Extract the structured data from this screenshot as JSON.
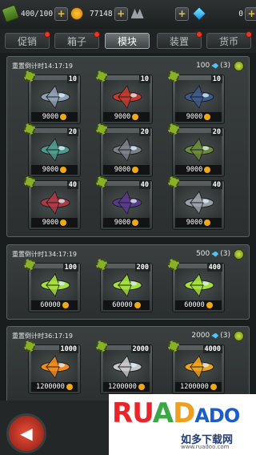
{
  "resources": {
    "energy": "400/100",
    "coins": "77148",
    "gems": "0"
  },
  "tabs": [
    {
      "label": "促销",
      "badge": true
    },
    {
      "label": "箱子",
      "badge": true
    },
    {
      "label": "模块",
      "badge": false,
      "active": true
    },
    {
      "label": "装置",
      "badge": true
    },
    {
      "label": "货币",
      "badge": true
    }
  ],
  "sections": [
    {
      "timer": "重置倒计时14:17:19",
      "cost": "100",
      "count": "(3)",
      "items": [
        {
          "level": "10",
          "price": "9000",
          "color": "#8fa0b3"
        },
        {
          "level": "10",
          "price": "9000",
          "color": "#c23a2e"
        },
        {
          "level": "10",
          "price": "9000",
          "color": "#3d5a8a"
        },
        {
          "level": "20",
          "price": "9000",
          "color": "#4e9a8c"
        },
        {
          "level": "20",
          "price": "9000",
          "color": "#7c8088"
        },
        {
          "level": "20",
          "price": "9000",
          "color": "#6c8a3a"
        },
        {
          "level": "40",
          "price": "9000",
          "color": "#b03a44"
        },
        {
          "level": "40",
          "price": "9000",
          "color": "#5a3a8a"
        },
        {
          "level": "40",
          "price": "9000",
          "color": "#9aa0a6"
        }
      ]
    },
    {
      "timer": "重置倒计时134:17:19",
      "cost": "500",
      "count": "(3)",
      "items": [
        {
          "level": "100",
          "price": "60000",
          "color": "#a5e03a"
        },
        {
          "level": "200",
          "price": "60000",
          "color": "#a5e03a"
        },
        {
          "level": "400",
          "price": "60000",
          "color": "#a5e03a"
        }
      ]
    },
    {
      "timer": "重置倒计时36:17:19",
      "cost": "2000",
      "count": "(3)",
      "items": [
        {
          "level": "1000",
          "price": "1200000",
          "color": "#f08a1c"
        },
        {
          "level": "2000",
          "price": "1200000",
          "color": "#c8c8c8"
        },
        {
          "level": "4000",
          "price": "1200000",
          "color": "#f0a21c"
        }
      ]
    }
  ],
  "watermark": {
    "letters": [
      "R",
      "U",
      "A",
      "D",
      "A",
      "D",
      "O"
    ],
    "subtitle": "如多下载网",
    "url": "www.ruadoo.com"
  }
}
